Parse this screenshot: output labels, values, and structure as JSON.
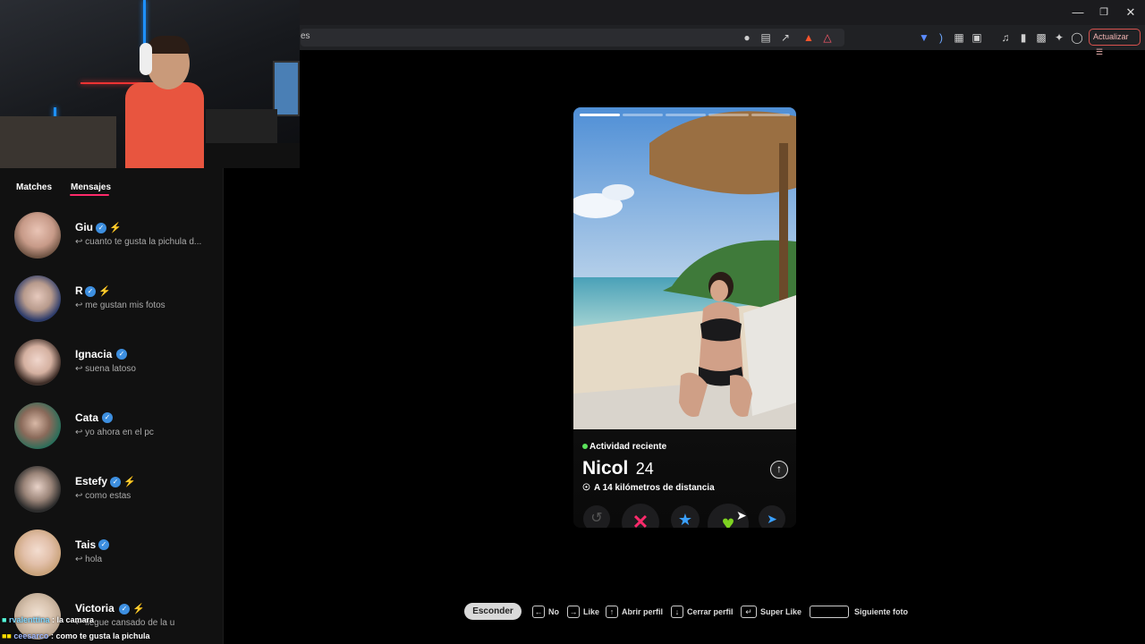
{
  "browser": {
    "address_fragment": "es",
    "update_label": "Actualizar"
  },
  "sidebar": {
    "tabs": [
      {
        "label": "Matches"
      },
      {
        "label": "Mensajes"
      }
    ],
    "conversations": [
      {
        "name": "Giu",
        "verified": true,
        "boost": true,
        "message": "cuanto te gusta la pichula d..."
      },
      {
        "name": "R",
        "verified": true,
        "boost": true,
        "message": "me gustan mis fotos"
      },
      {
        "name": "Ignacia",
        "verified": true,
        "boost": false,
        "message": "suena latoso"
      },
      {
        "name": "Cata",
        "verified": true,
        "boost": false,
        "message": "yo ahora en el pc"
      },
      {
        "name": "Estefy",
        "verified": true,
        "boost": true,
        "message": "como estas"
      },
      {
        "name": "Tais",
        "verified": true,
        "boost": false,
        "message": "hola"
      },
      {
        "name": "Victoria",
        "verified": true,
        "boost": true,
        "message": "llegue cansado de la u"
      }
    ]
  },
  "chat_overlay": [
    {
      "user": "rvalenttina",
      "text": "la camara"
    },
    {
      "user": "ceesarco",
      "text": "como te gusta la pichula"
    }
  ],
  "profile": {
    "activity": "Actividad reciente",
    "name": "Nicol",
    "age": "24",
    "distance": "A 14 kilómetros de distancia",
    "photo_count": 5,
    "current_photo": 1
  },
  "actions": [
    {
      "icon": "rewind-icon"
    },
    {
      "icon": "nope-icon"
    },
    {
      "icon": "super-like-icon"
    },
    {
      "icon": "like-heart-icon"
    },
    {
      "icon": "boost-send-icon"
    }
  ],
  "shortcuts": {
    "hide_label": "Esconder",
    "items": [
      {
        "label": "No"
      },
      {
        "label": "Like"
      },
      {
        "label": "Abrir perfil"
      },
      {
        "label": "Cerrar perfil"
      },
      {
        "label": "Super Like"
      },
      {
        "label": "Siguiente foto"
      }
    ]
  },
  "colors": {
    "accent": "#fd2a6b",
    "verified": "#3d8fe0",
    "boost": "#a557e8",
    "active_dot": "#5be25b"
  }
}
